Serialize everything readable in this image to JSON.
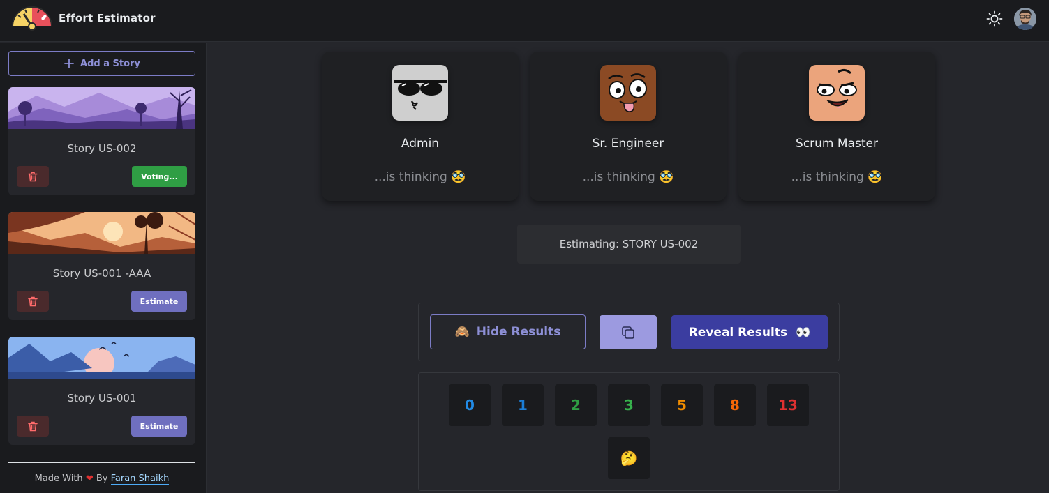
{
  "header": {
    "app_title": "Effort Estimator",
    "theme_toggle_icon": "sun-icon",
    "colors": {
      "background": "#1a1b1e",
      "gauge_yellow": "#f6d365",
      "gauge_red": "#e8505b"
    }
  },
  "sidebar": {
    "add_story_label": "Add a Story",
    "stories": [
      {
        "title": "Story US-002",
        "action_label": "Voting...",
        "action_color": "#2f9e44",
        "banner": "purple-mountains"
      },
      {
        "title": "Story US-001 -AAA",
        "action_label": "Estimate",
        "action_color": "#6f6fbf",
        "banner": "sunset-cliffs"
      },
      {
        "title": "Story US-001",
        "action_label": "Estimate",
        "action_color": "#6f6fbf",
        "banner": "blue-lake"
      }
    ],
    "footer": {
      "made_with": "Made With",
      "by": "By",
      "author": "Faran Shaikh"
    }
  },
  "players": [
    {
      "name": "Admin",
      "status": "...is thinking 🥸",
      "avatar": "sunglasses-face"
    },
    {
      "name": "Sr. Engineer",
      "status": "...is thinking 🥸",
      "avatar": "tongue-face"
    },
    {
      "name": "Scrum Master",
      "status": "...is thinking 🥸",
      "avatar": "smirk-face"
    }
  ],
  "estimating": "Estimating: STORY US-002",
  "controls": {
    "hide_emoji": "🙈",
    "hide_label": "Hide Results",
    "copy_icon": "copy-icon",
    "reveal_label": "Reveal Results",
    "reveal_emoji": "👀"
  },
  "cards": [
    {
      "label": "0",
      "color": "#228be6"
    },
    {
      "label": "1",
      "color": "#1c7ed6"
    },
    {
      "label": "2",
      "color": "#2f9e44"
    },
    {
      "label": "3",
      "color": "#37b24d"
    },
    {
      "label": "5",
      "color": "#f08c00"
    },
    {
      "label": "8",
      "color": "#f76707"
    },
    {
      "label": "13",
      "color": "#e03131"
    },
    {
      "label": "🤔",
      "color": "#fab005"
    }
  ]
}
